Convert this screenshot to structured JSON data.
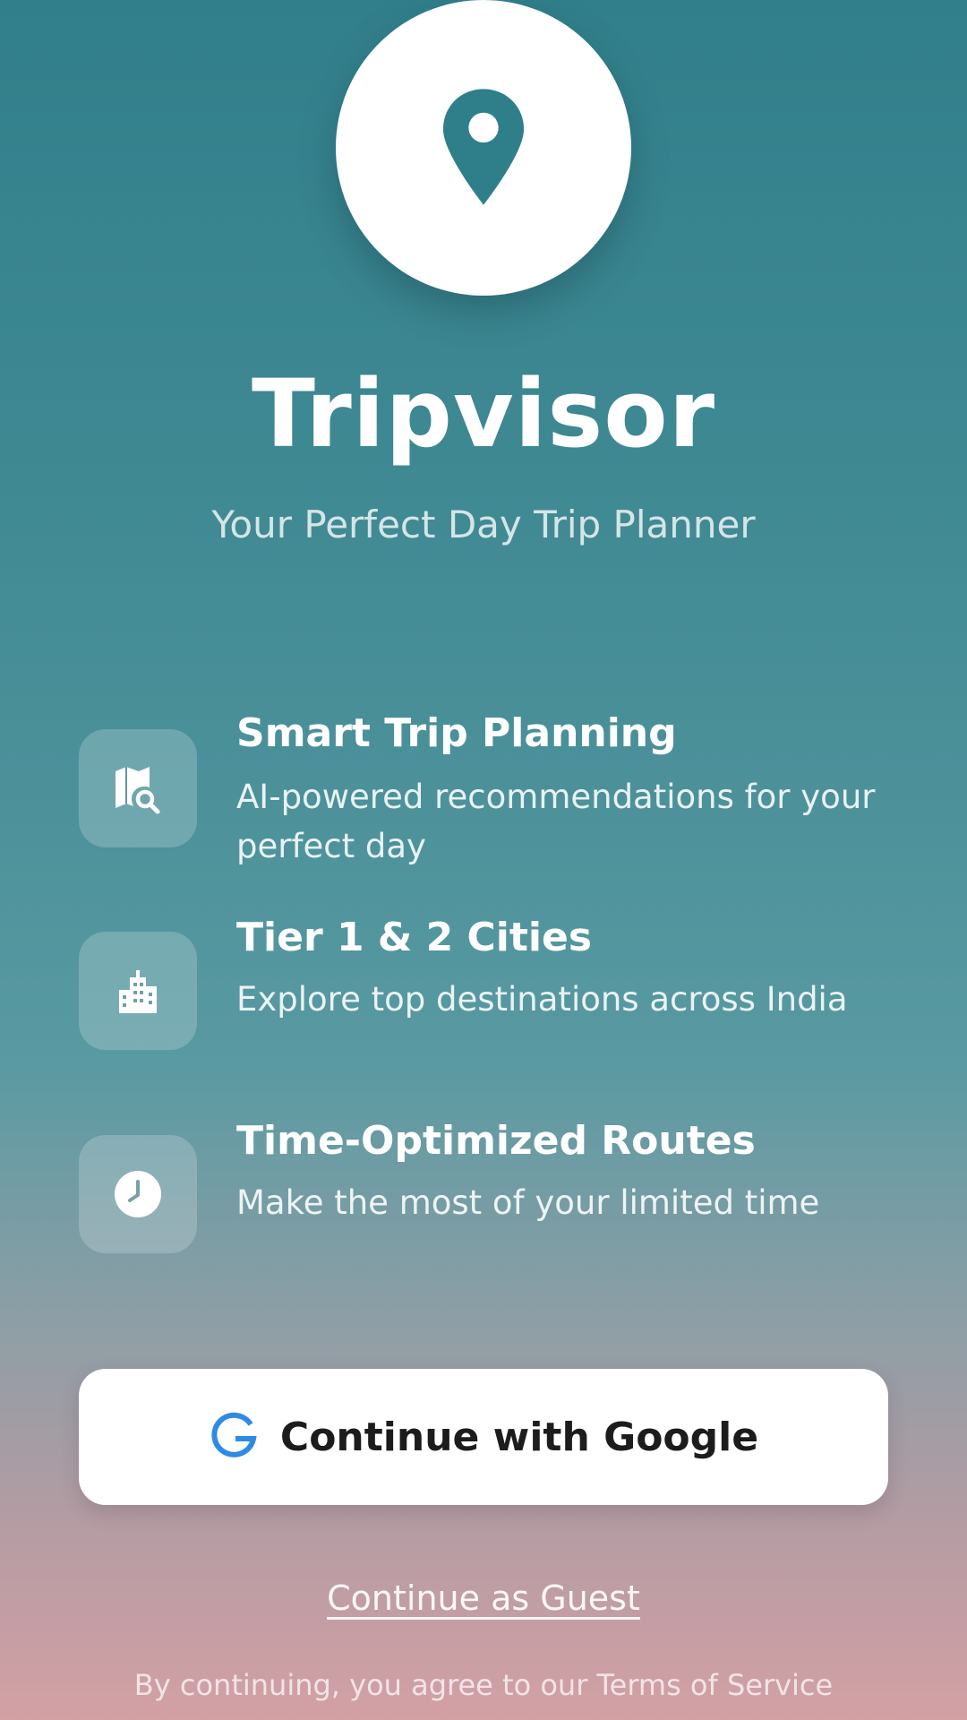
{
  "brand": {
    "logo_icon": "map-pin-icon",
    "title": "Tripvisor",
    "subtitle": "Your Perfect Day Trip Planner",
    "accent_color": "#2f7f8b"
  },
  "features": [
    {
      "icon": "map-search-icon",
      "title": "Smart Trip Planning",
      "description": "AI-powered recommendations for your perfect day"
    },
    {
      "icon": "city-buildings-icon",
      "title": "Tier 1 & 2 Cities",
      "description": "Explore top destinations across India"
    },
    {
      "icon": "clock-icon",
      "title": "Time-Optimized Routes",
      "description": "Make the most of your limited time"
    }
  ],
  "auth": {
    "google_button_label": "Continue with Google",
    "google_icon": "google-g-icon",
    "guest_label": "Continue as Guest",
    "terms_text": "By continuing, you agree to our Terms of Service"
  },
  "colors": {
    "gradient_top": "#317f8b",
    "gradient_bottom": "#d3a0a4",
    "google_blue": "#2f8ae5"
  }
}
